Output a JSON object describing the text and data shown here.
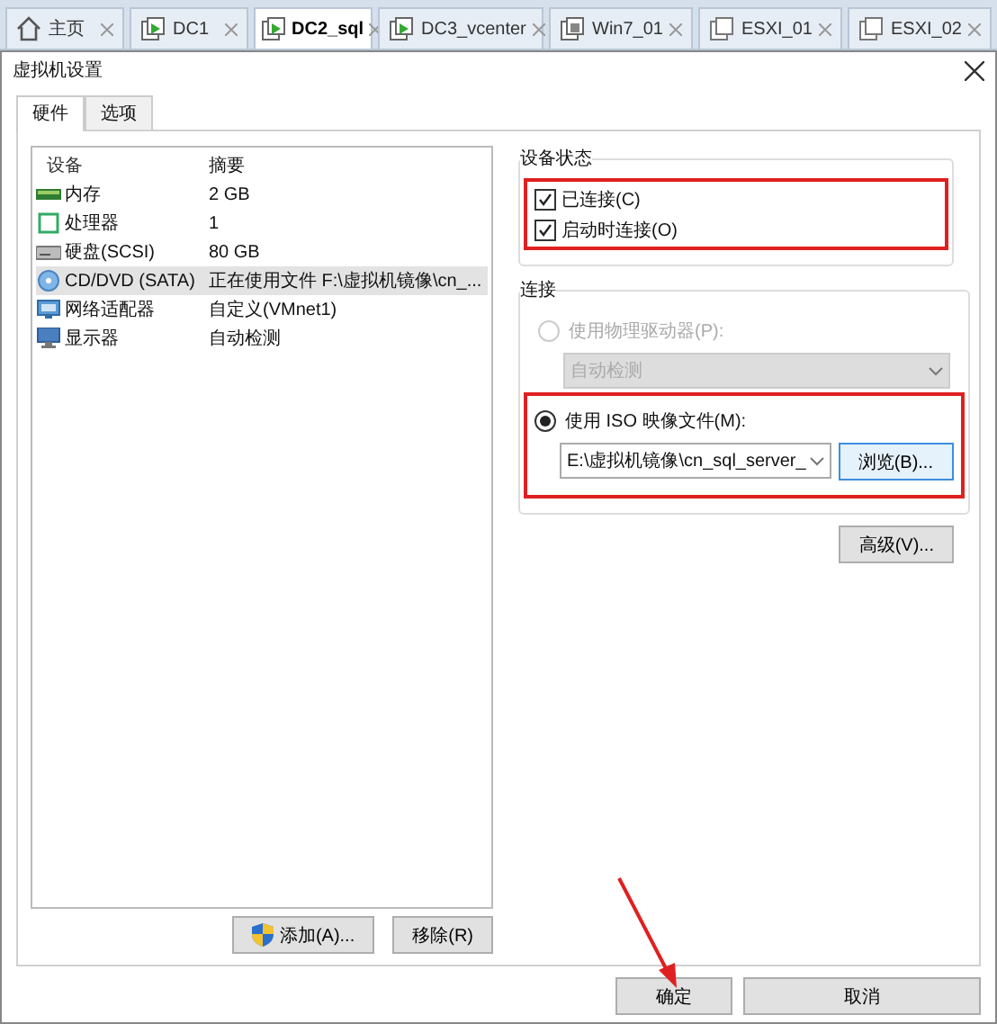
{
  "browser_tabs": [
    {
      "label": "主页",
      "kind": "home",
      "selected": false
    },
    {
      "label": "DC1",
      "kind": "running",
      "selected": false
    },
    {
      "label": "DC2_sql",
      "kind": "running",
      "selected": true
    },
    {
      "label": "DC3_vcenter",
      "kind": "running",
      "selected": false
    },
    {
      "label": "Win7_01",
      "kind": "stopped",
      "selected": false
    },
    {
      "label": "ESXI_01",
      "kind": "idle",
      "selected": false
    },
    {
      "label": "ESXI_02",
      "kind": "idle",
      "selected": false
    }
  ],
  "dialog": {
    "title": "虚拟机设置"
  },
  "tabs": [
    {
      "label": "硬件",
      "selected": true
    },
    {
      "label": "选项",
      "selected": false
    }
  ],
  "hardware": {
    "columns": [
      "设备",
      "摘要"
    ],
    "rows": [
      {
        "device": "内存",
        "summary": "2 GB",
        "kind": "memory",
        "selected": false
      },
      {
        "device": "处理器",
        "summary": "1",
        "kind": "cpu",
        "selected": false
      },
      {
        "device": "硬盘(SCSI)",
        "summary": "80 GB",
        "kind": "disk",
        "selected": false
      },
      {
        "device": "CD/DVD (SATA)",
        "summary": "正在使用文件 F:\\虚拟机镜像\\cn_...",
        "kind": "cd",
        "selected": true
      },
      {
        "device": "网络适配器",
        "summary": "自定义(VMnet1)",
        "kind": "network",
        "selected": false
      },
      {
        "device": "显示器",
        "summary": "自动检测",
        "kind": "display",
        "selected": false
      }
    ]
  },
  "add_button": "添加(A)...",
  "remove_button": "移除(R)",
  "device_status": {
    "title": "设备状态",
    "highlighted": true,
    "options": [
      {
        "label": "已连接(C)",
        "checked": true
      },
      {
        "label": "启动时连接(O)",
        "checked": true
      }
    ]
  },
  "connection": {
    "title": "连接",
    "options": [
      {
        "kind": "dropdown",
        "label": "使用物理驱动器(P):",
        "selected": false,
        "disabled": true,
        "value": "自动检测",
        "highlighted": false
      },
      {
        "kind": "file",
        "label": "使用 ISO 映像文件(M):",
        "selected": true,
        "disabled": false,
        "value": "E:\\虚拟机镜像\\cn_sql_server_",
        "button": "浏览(B)...",
        "highlighted": true
      }
    ]
  },
  "advanced_button": "高级(V)...",
  "footer": {
    "buttons": [
      {
        "label": "确定",
        "pointed": true
      },
      {
        "label": "取消",
        "pointed": false
      }
    ]
  }
}
